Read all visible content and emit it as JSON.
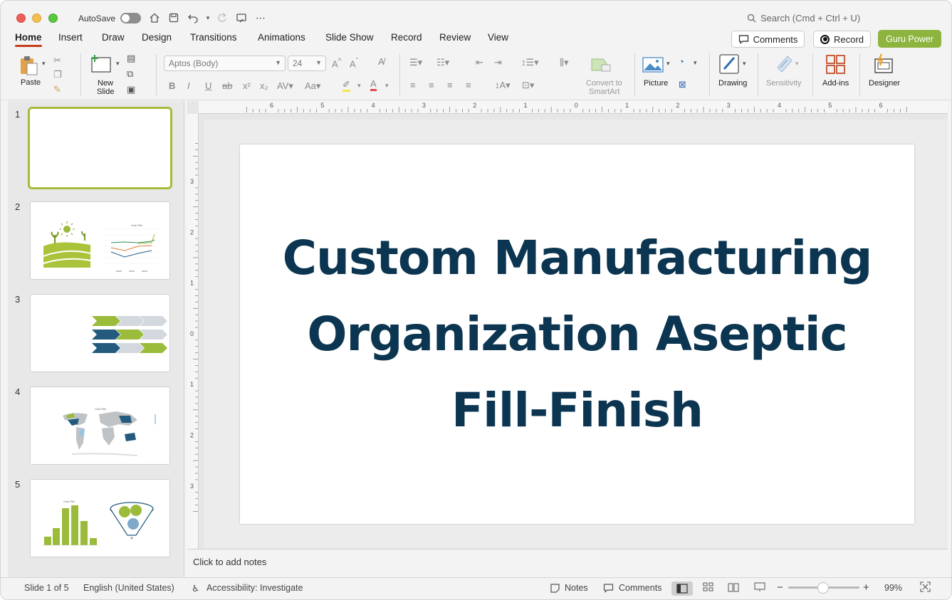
{
  "titlebar": {
    "autosave_label": "AutoSave",
    "search_placeholder": "Search (Cmd + Ctrl + U)"
  },
  "tabs": [
    "Home",
    "Insert",
    "Draw",
    "Design",
    "Transitions",
    "Animations",
    "Slide Show",
    "Record",
    "Review",
    "View"
  ],
  "actions": {
    "comments": "Comments",
    "record": "Record",
    "guru": "Guru Power"
  },
  "ribbon": {
    "paste": "Paste",
    "new_slide_1": "New",
    "new_slide_2": "Slide",
    "font_name": "Aptos (Body)",
    "font_size": "24",
    "convert_1": "Convert to",
    "convert_2": "SmartArt",
    "picture": "Picture",
    "drawing": "Drawing",
    "sensitivity": "Sensitivity",
    "addins": "Add-ins",
    "designer": "Designer"
  },
  "ruler": {
    "h_ticks": [
      "6",
      "5",
      "4",
      "3",
      "2",
      "1",
      "0",
      "1",
      "2",
      "3",
      "4",
      "5",
      "6"
    ],
    "v_ticks": [
      "3",
      "2",
      "1",
      "0",
      "1",
      "2",
      "3"
    ]
  },
  "thumbnails": [
    {
      "num": "1"
    },
    {
      "num": "2",
      "chart_title": "Chart Title"
    },
    {
      "num": "3"
    },
    {
      "num": "4",
      "chart_title": "Chart Title"
    },
    {
      "num": "5",
      "chart_title": "Chart Title"
    }
  ],
  "slide": {
    "title": "Custom Manufacturing Organization Aseptic Fill-Finish"
  },
  "notes_placeholder": "Click to add notes",
  "status": {
    "slide_count": "Slide 1 of 5",
    "language": "English (United States)",
    "accessibility": "Accessibility: Investigate",
    "notes": "Notes",
    "comments": "Comments",
    "zoom": "99%"
  },
  "colors": {
    "accent_green": "#8db43e",
    "title_navy": "#0b3550",
    "home_underline": "#c43e1c"
  }
}
